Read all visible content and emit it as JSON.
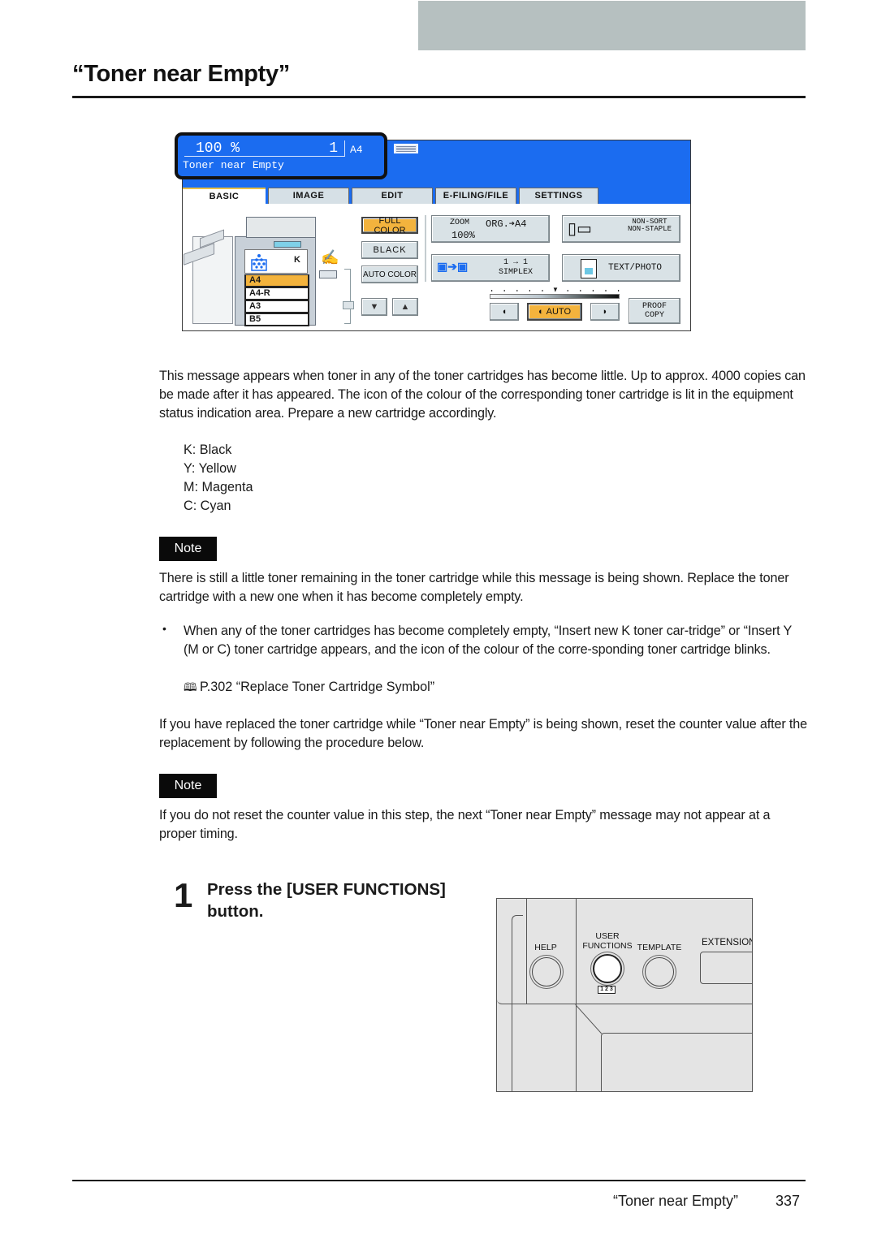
{
  "page": {
    "title": "“Toner near Empty”",
    "footer_title": "“Toner near Empty”",
    "page_number": "337"
  },
  "copier_panel": {
    "status": {
      "zoom": "100  %",
      "copies": "1",
      "paper": "A4",
      "message": "Toner near Empty"
    },
    "tabs": [
      {
        "label": "BASIC",
        "active": true
      },
      {
        "label": "IMAGE",
        "active": false
      },
      {
        "label": "EDIT",
        "active": false
      },
      {
        "label": "E-FILING/FILE",
        "active": false
      },
      {
        "label": "SETTINGS",
        "active": false
      }
    ],
    "toner_label": "K",
    "paper_sizes": [
      {
        "label": "A4",
        "selected": true
      },
      {
        "label": "A4-R",
        "selected": false
      },
      {
        "label": "A3",
        "selected": false
      },
      {
        "label": "B5",
        "selected": false
      }
    ],
    "color_modes": {
      "full_color": "FULL COLOR",
      "black": "BLACK",
      "auto_color": "AUTO COLOR",
      "selected": "FULL COLOR"
    },
    "zoom_button": {
      "label": "ZOOM",
      "org": "ORG.➔A4",
      "value": "100%"
    },
    "sort_button": {
      "line1": "NON-SORT",
      "line2": "NON-STAPLE"
    },
    "simplex_button": {
      "line1": "1 → 1",
      "line2": "SIMPLEX"
    },
    "original_mode": "TEXT/PHOTO",
    "density": {
      "mode": "AUTO",
      "level": 0.5
    },
    "proof_copy": "PROOF\nCOPY"
  },
  "content": {
    "intro": "This message appears when toner in any of the toner cartridges has become little. Up to approx. 4000 copies can be made after it has appeared. The icon of the colour of the corresponding toner cartridge is lit in the equipment status indication area. Prepare a new cartridge accordingly.",
    "colors": [
      "K: Black",
      "Y: Yellow",
      "M: Magenta",
      "C: Cyan"
    ],
    "note_label": "Note",
    "note1": "There is still a little toner remaining in the toner cartridge while this message is being shown. Replace the toner cartridge with a new one when it has become completely empty.",
    "bullet": "When any of the toner cartridges has become completely empty, “Insert new K toner car-tridge” or “Insert Y (M or C) toner cartridge appears, and the icon of the colour of the corre-sponding toner cartridge blinks.",
    "reference": "P.302 “Replace Toner Cartridge Symbol”",
    "para_reset": "If you have replaced the toner cartridge while “Toner near Empty” is being shown, reset the counter value after the replacement by following the procedure below.",
    "note2": "If you do not reset the counter value in this step, the next “Toner near Empty” message may not appear at a proper timing."
  },
  "step": {
    "number": "1",
    "text": "Press the [USER FUNCTIONS] button."
  },
  "control_panel": {
    "help": "HELP",
    "user_functions": "USER\nFUNCTIONS",
    "template": "TEMPLATE",
    "extension": "EXTENSION",
    "badge": "1 2 3"
  }
}
